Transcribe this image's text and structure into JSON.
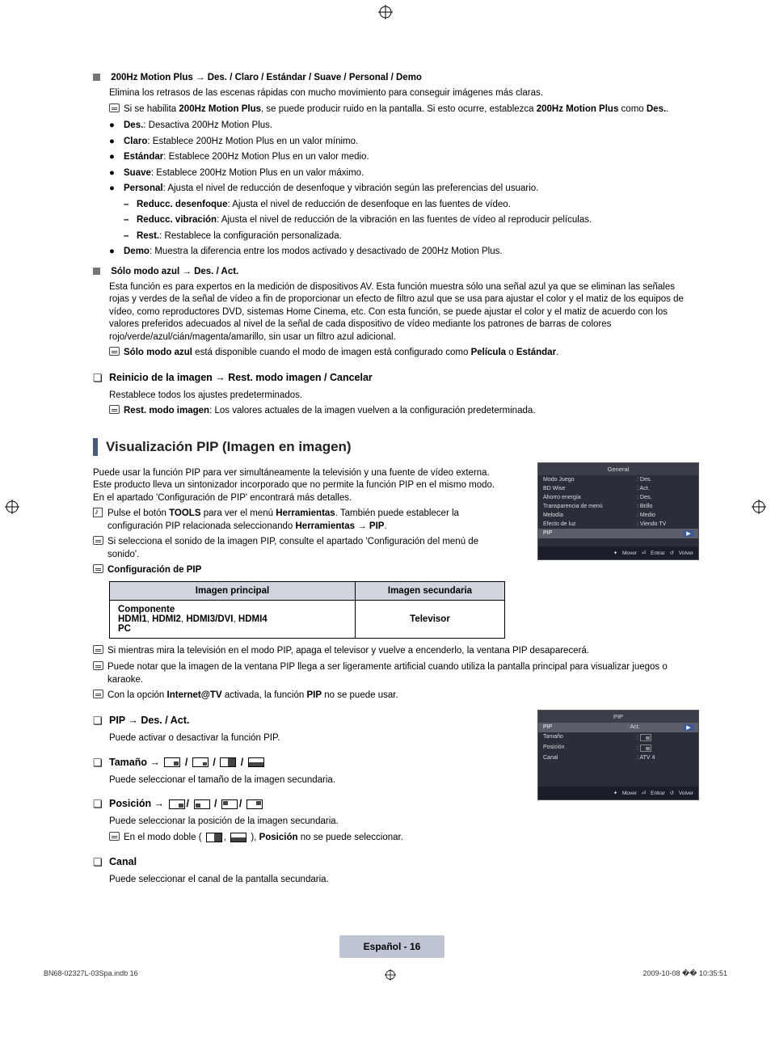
{
  "section1": {
    "title_prefix": "200Hz Motion Plus → ",
    "title_opts": "Des. / Claro / Estándar / Suave / Personal / Demo",
    "intro": "Elimina los retrasos de las escenas rápidas con mucho movimiento para conseguir imágenes más claras.",
    "note1_a": "Si se habilita ",
    "note1_b": "200Hz Motion Plus",
    "note1_c": ", se puede producir ruido en la pantalla. Si esto ocurre, establezca ",
    "note1_d": "200Hz Motion Plus",
    "note1_e": " como ",
    "note1_f": "Des.",
    "note1_g": ".",
    "b_des_t": "Des.",
    "b_des": ": Desactiva 200Hz Motion Plus.",
    "b_claro_t": "Claro",
    "b_claro": ": Establece 200Hz Motion Plus en un valor mínimo.",
    "b_est_t": "Estándar",
    "b_est": ": Establece 200Hz Motion Plus en un valor medio.",
    "b_sua_t": "Suave",
    "b_sua": ": Establece 200Hz Motion Plus en un valor máximo.",
    "b_per_t": "Personal",
    "b_per": ": Ajusta el nivel de reducción de desenfoque y vibración según las preferencias del usuario.",
    "d1_t": "Reducc. desenfoque",
    "d1": ": Ajusta el nivel de reducción de desenfoque en las fuentes de vídeo.",
    "d2_t": "Reducc. vibración",
    "d2": ": Ajusta el nivel de reducción de la vibración en las fuentes de vídeo al reproducir películas.",
    "d3_t": "Rest.",
    "d3": ": Restablece la configuración personalizada.",
    "b_demo_t": "Demo",
    "b_demo": ": Muestra la diferencia entre los modos activado y desactivado de 200Hz Motion Plus."
  },
  "section2": {
    "title_prefix": "Sólo modo azul → ",
    "title_opts": "Des. / Act.",
    "para": "Esta función es para expertos en la medición de dispositivos AV. Esta función muestra sólo una señal azul ya que se eliminan las señales rojas y verdes de la señal de vídeo a fin de proporcionar un efecto de filtro azul que se usa para ajustar el color y el matiz de los equipos de vídeo, como reproductores DVD, sistemas Home Cinema, etc. Con esta función, se puede ajustar el color y el matiz de acuerdo con los valores preferidos adecuados al nivel de la señal de cada dispositivo de vídeo mediante los patrones de barras de colores rojo/verde/azul/cián/magenta/amarillo, sin usar un filtro azul adicional.",
    "note_a": "Sólo modo azul",
    "note_b": " está disponible cuando el modo de imagen está configurado como ",
    "note_c": "Película",
    "note_d": " o ",
    "note_e": "Estándar",
    "note_f": "."
  },
  "section3": {
    "q_title": "Reinicio de la imagen → Rest. modo imagen / Cancelar",
    "p1": "Restablece todos los ajustes predeterminados.",
    "note_a": "Rest. modo imagen",
    "note_b": ": Los valores actuales de la imagen vuelven a la configuración predeterminada."
  },
  "sectionPIP": {
    "heading": "Visualización PIP (Imagen en imagen)",
    "intro": "Puede usar la función PIP para ver simultáneamente la televisión y una fuente de vídeo externa. Este producto lleva un sintonizador incorporado que no permite la función PIP en el mismo modo. En el apartado 'Configuración de PIP' encontrará más detalles.",
    "tool_a": "Pulse el botón ",
    "tool_b": "TOOLS",
    "tool_c": " para ver el menú ",
    "tool_d": "Herramientas",
    "tool_e": ". También puede establecer la configuración PIP relacionada seleccionando ",
    "tool_f": "Herramientas → PIP",
    "tool_g": ".",
    "note_sound": "Si selecciona el sonido de la imagen PIP, consulte el apartado 'Configuración del menú de sonido'.",
    "note_conf": "Configuración de PIP",
    "th1": "Imagen principal",
    "th2": "Imagen secundaria",
    "td1a": "Componente",
    "td1b_a": "HDMI1",
    "td1b_b": ", ",
    "td1b_c": "HDMI2",
    "td1b_d": ", ",
    "td1b_e": "HDMI3/DVI",
    "td1b_f": ", ",
    "td1b_g": "HDMI4",
    "td1c": "PC",
    "td2": "Televisor",
    "note_off": "Si mientras mira la televisión en el modo PIP, apaga el televisor y vuelve a encenderlo, la ventana PIP desaparecerá.",
    "note_art": "Puede notar que la imagen de la ventana PIP llega a ser ligeramente artificial cuando utiliza la pantalla principal para visualizar juegos o karaoke.",
    "note_internet_a": "Con la opción ",
    "note_internet_b": "Internet@TV",
    "note_internet_c": " activada, la función ",
    "note_internet_d": "PIP",
    "note_internet_e": " no se puede usar.",
    "q_pip": "PIP → Des. / Act.",
    "q_pip_p": "Puede activar o desactivar la función PIP.",
    "q_tam": "Tamaño → ",
    "q_tam_p": "Puede seleccionar el tamaño de la imagen secundaria.",
    "q_pos": "Posición → ",
    "q_pos_p": "Puede seleccionar la posición de la imagen secundaria.",
    "q_pos_note_a": "En el modo doble (",
    "q_pos_note_b": "), ",
    "q_pos_note_c": "Posición",
    "q_pos_note_d": " no se puede seleccionar.",
    "q_canal": "Canal",
    "q_canal_p": "Puede seleccionar el canal de la pantalla secundaria."
  },
  "osd1": {
    "title": "General",
    "rows": [
      {
        "l": "Modo Juego",
        "r": ": Des."
      },
      {
        "l": "BD Wise",
        "r": ": Act."
      },
      {
        "l": "Ahorro energía",
        "r": ": Des."
      },
      {
        "l": "Transparencia de menú",
        "r": ": Brillo"
      },
      {
        "l": "Melodía",
        "r": ": Medio"
      },
      {
        "l": "Efecto de luz",
        "r": ": Viendo TV"
      }
    ],
    "hi": "PIP",
    "footer": {
      "move": "Mover",
      "enter": "Entrar",
      "ret": "Volver"
    }
  },
  "osd2": {
    "title": "PIP",
    "hi_l": "PIP",
    "hi_r": ": Act.",
    "rows": [
      {
        "l": "Tamaño",
        "r": ":"
      },
      {
        "l": "Posición",
        "r": ":"
      },
      {
        "l": "Canal",
        "r": ": ATV 4"
      }
    ],
    "footer": {
      "move": "Mover",
      "enter": "Entrar",
      "ret": "Volver"
    }
  },
  "pageLang": "Español - 16",
  "footer": {
    "left": "BN68-02327L-03Spa.indb   16",
    "right": "2009-10-08   �� 10:35:51"
  }
}
